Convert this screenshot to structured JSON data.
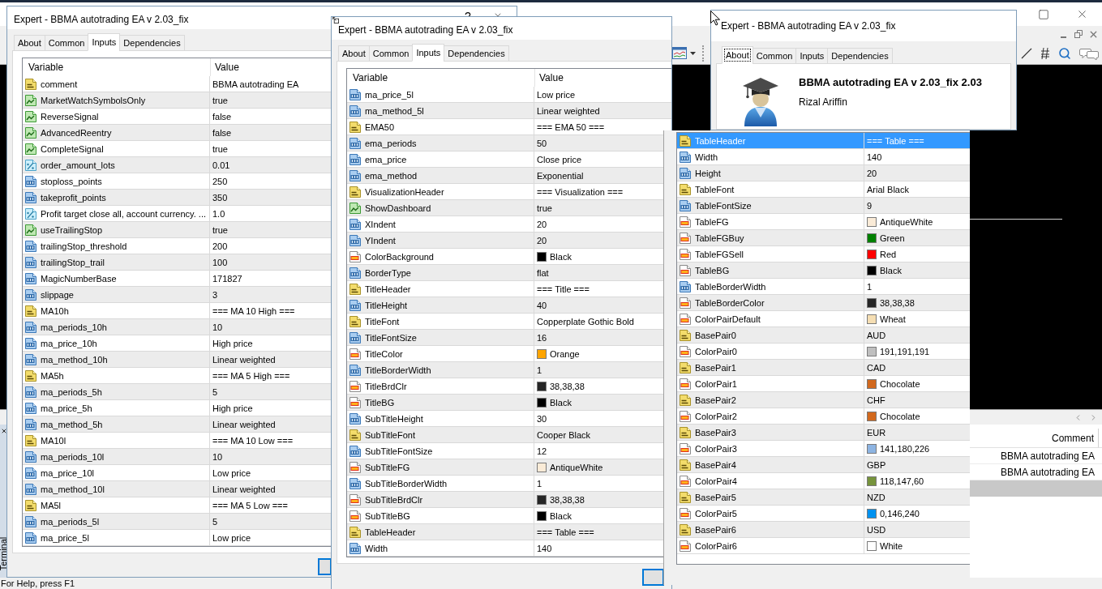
{
  "dialogs": [
    {
      "kind": "inputs",
      "title": "Expert - BBMA autotrading EA v 2.03_fix",
      "title_buttons": [
        {
          "kind": "help",
          "label": "?"
        },
        {
          "kind": "close"
        }
      ],
      "tabs": [
        {
          "label": "About",
          "selected": false
        },
        {
          "label": "Common",
          "selected": false
        },
        {
          "label": "Inputs",
          "selected": true
        },
        {
          "label": "Dependencies",
          "selected": false
        }
      ],
      "columns": [
        "Variable",
        "Value"
      ],
      "rows": [
        {
          "kind": "string",
          "variable": "comment",
          "value": "BBMA autotrading EA",
          "selected": false
        },
        {
          "kind": "bool",
          "variable": "MarketWatchSymbolsOnly",
          "value": "true",
          "selected": false
        },
        {
          "kind": "bool",
          "variable": "ReverseSignal",
          "value": "false",
          "selected": false
        },
        {
          "kind": "bool",
          "variable": "AdvancedReentry",
          "value": "false",
          "selected": false
        },
        {
          "kind": "bool",
          "variable": "CompleteSignal",
          "value": "true",
          "selected": false
        },
        {
          "kind": "double",
          "variable": "order_amount_lots",
          "value": "0.01",
          "selected": false
        },
        {
          "kind": "int",
          "variable": "stoploss_points",
          "value": "250",
          "selected": false
        },
        {
          "kind": "int",
          "variable": "takeprofit_points",
          "value": "350",
          "selected": false
        },
        {
          "kind": "double",
          "variable": "Profit target close all, account currency. ...",
          "value": "1.0",
          "selected": false
        },
        {
          "kind": "bool",
          "variable": "useTrailingStop",
          "value": "true",
          "selected": false
        },
        {
          "kind": "int",
          "variable": "trailingStop_threshold",
          "value": "200",
          "selected": false
        },
        {
          "kind": "int",
          "variable": "trailingStop_trail",
          "value": "100",
          "selected": false
        },
        {
          "kind": "int",
          "variable": "MagicNumberBase",
          "value": "171827",
          "selected": false
        },
        {
          "kind": "int",
          "variable": "slippage",
          "value": "3",
          "selected": false
        },
        {
          "kind": "string",
          "variable": "MA10h",
          "value": "=== MA 10 High ===",
          "selected": false
        },
        {
          "kind": "int",
          "variable": "ma_periods_10h",
          "value": "10",
          "selected": false
        },
        {
          "kind": "int",
          "variable": "ma_price_10h",
          "value": "High price",
          "selected": false
        },
        {
          "kind": "int",
          "variable": "ma_method_10h",
          "value": "Linear weighted",
          "selected": false
        },
        {
          "kind": "string",
          "variable": "MA5h",
          "value": "=== MA 5 High ===",
          "selected": false
        },
        {
          "kind": "int",
          "variable": "ma_periods_5h",
          "value": "5",
          "selected": false
        },
        {
          "kind": "int",
          "variable": "ma_price_5h",
          "value": "High price",
          "selected": false
        },
        {
          "kind": "int",
          "variable": "ma_method_5h",
          "value": "Linear weighted",
          "selected": false
        },
        {
          "kind": "string",
          "variable": "MA10l",
          "value": "=== MA 10 Low ===",
          "selected": false
        },
        {
          "kind": "int",
          "variable": "ma_periods_10l",
          "value": "10",
          "selected": false
        },
        {
          "kind": "int",
          "variable": "ma_price_10l",
          "value": "Low price",
          "selected": false
        },
        {
          "kind": "int",
          "variable": "ma_method_10l",
          "value": "Linear weighted",
          "selected": false
        },
        {
          "kind": "string",
          "variable": "MA5l",
          "value": "=== MA 5 Low ===",
          "selected": false
        },
        {
          "kind": "int",
          "variable": "ma_periods_5l",
          "value": "5",
          "selected": false
        },
        {
          "kind": "int",
          "variable": "ma_price_5l",
          "value": "Low price",
          "selected": false
        }
      ]
    },
    {
      "kind": "inputs",
      "title": "Expert - BBMA autotrading EA v 2.03_fix",
      "tabs": [
        {
          "label": "About",
          "selected": false
        },
        {
          "label": "Common",
          "selected": false
        },
        {
          "label": "Inputs",
          "selected": true
        },
        {
          "label": "Dependencies",
          "selected": false
        }
      ],
      "columns": [
        "Variable",
        "Value"
      ],
      "rows": [
        {
          "kind": "int",
          "variable": "ma_price_5l",
          "value": "Low price",
          "selected": false
        },
        {
          "kind": "int",
          "variable": "ma_method_5l",
          "value": "Linear weighted",
          "selected": false
        },
        {
          "kind": "string",
          "variable": "EMA50",
          "value": "=== EMA 50 ===",
          "selected": false
        },
        {
          "kind": "int",
          "variable": "ema_periods",
          "value": "50",
          "selected": false
        },
        {
          "kind": "int",
          "variable": "ema_price",
          "value": "Close price",
          "selected": false
        },
        {
          "kind": "int",
          "variable": "ema_method",
          "value": "Exponential",
          "selected": false
        },
        {
          "kind": "string",
          "variable": "VisualizationHeader",
          "value": "=== Visualization ===",
          "selected": false
        },
        {
          "kind": "bool",
          "variable": "ShowDashboard",
          "value": "true",
          "selected": false
        },
        {
          "kind": "int",
          "variable": "XIndent",
          "value": "20",
          "selected": false
        },
        {
          "kind": "int",
          "variable": "YIndent",
          "value": "20",
          "selected": false
        },
        {
          "kind": "color",
          "variable": "ColorBackground",
          "value": "Black",
          "color": "#000000",
          "selected": false
        },
        {
          "kind": "int",
          "variable": "BorderType",
          "value": "flat",
          "selected": false
        },
        {
          "kind": "string",
          "variable": "TitleHeader",
          "value": "=== Title ===",
          "selected": false
        },
        {
          "kind": "int",
          "variable": "TitleHeight",
          "value": "40",
          "selected": false
        },
        {
          "kind": "string",
          "variable": "TitleFont",
          "value": "Copperplate Gothic Bold",
          "selected": false
        },
        {
          "kind": "int",
          "variable": "TitleFontSize",
          "value": "16",
          "selected": false
        },
        {
          "kind": "color",
          "variable": "TitleColor",
          "value": "Orange",
          "color": "#ffa500",
          "selected": false
        },
        {
          "kind": "int",
          "variable": "TitleBorderWidth",
          "value": "1",
          "selected": false
        },
        {
          "kind": "color",
          "variable": "TitleBrdClr",
          "value": "38,38,38",
          "color": "#262626",
          "selected": false
        },
        {
          "kind": "color",
          "variable": "TitleBG",
          "value": "Black",
          "color": "#000000",
          "selected": false
        },
        {
          "kind": "int",
          "variable": "SubTitleHeight",
          "value": "30",
          "selected": false
        },
        {
          "kind": "string",
          "variable": "SubTitleFont",
          "value": "Cooper Black",
          "selected": false
        },
        {
          "kind": "int",
          "variable": "SubTitleFontSize",
          "value": "12",
          "selected": false
        },
        {
          "kind": "color",
          "variable": "SubTitleFG",
          "value": "AntiqueWhite",
          "color": "#faebd7",
          "selected": false
        },
        {
          "kind": "int",
          "variable": "SubTitleBorderWidth",
          "value": "1",
          "selected": false
        },
        {
          "kind": "color",
          "variable": "SubTitleBrdClr",
          "value": "38,38,38",
          "color": "#262626",
          "selected": false
        },
        {
          "kind": "color",
          "variable": "SubTitleBG",
          "value": "Black",
          "color": "#000000",
          "selected": false
        },
        {
          "kind": "string",
          "variable": "TableHeader",
          "value": "=== Table ===",
          "selected": false
        },
        {
          "kind": "int",
          "variable": "Width",
          "value": "140",
          "selected": false
        }
      ]
    },
    {
      "kind": "about",
      "title": "Expert - BBMA autotrading EA v 2.03_fix",
      "tabs": [
        {
          "label": "About",
          "selected": true,
          "focused": true
        },
        {
          "label": "Common",
          "selected": false,
          "focused": false
        },
        {
          "label": "Inputs",
          "selected": false,
          "focused": false
        },
        {
          "label": "Dependencies",
          "selected": false,
          "focused": false
        }
      ],
      "about": {
        "name": "BBMA autotrading EA v 2.03_fix 2.03",
        "author": "Rizal Ariffin"
      }
    }
  ],
  "inputs_panel": {
    "rows": [
      {
        "kind": "string",
        "variable": "TableHeader",
        "value": "=== Table ===",
        "selected": true
      },
      {
        "kind": "int",
        "variable": "Width",
        "value": "140",
        "selected": false
      },
      {
        "kind": "int",
        "variable": "Height",
        "value": "20",
        "selected": false
      },
      {
        "kind": "string",
        "variable": "TableFont",
        "value": "Arial Black",
        "selected": false
      },
      {
        "kind": "int",
        "variable": "TableFontSize",
        "value": "9",
        "selected": false
      },
      {
        "kind": "color",
        "variable": "TableFG",
        "value": "AntiqueWhite",
        "color": "#faebd7",
        "selected": false
      },
      {
        "kind": "color",
        "variable": "TableFGBuy",
        "value": "Green",
        "color": "#008000",
        "selected": false
      },
      {
        "kind": "color",
        "variable": "TableFGSell",
        "value": "Red",
        "color": "#ff0000",
        "selected": false
      },
      {
        "kind": "color",
        "variable": "TableBG",
        "value": "Black",
        "color": "#000000",
        "selected": false
      },
      {
        "kind": "int",
        "variable": "TableBorderWidth",
        "value": "1",
        "selected": false
      },
      {
        "kind": "color",
        "variable": "TableBorderColor",
        "value": "38,38,38",
        "color": "#262626",
        "selected": false
      },
      {
        "kind": "color",
        "variable": "ColorPairDefault",
        "value": "Wheat",
        "color": "#f5deb3",
        "selected": false
      },
      {
        "kind": "string",
        "variable": "BasePair0",
        "value": "AUD",
        "selected": false
      },
      {
        "kind": "color",
        "variable": "ColorPair0",
        "value": "191,191,191",
        "color": "#bfbfbf",
        "selected": false
      },
      {
        "kind": "string",
        "variable": "BasePair1",
        "value": "CAD",
        "selected": false
      },
      {
        "kind": "color",
        "variable": "ColorPair1",
        "value": "Chocolate",
        "color": "#d2691e",
        "selected": false
      },
      {
        "kind": "string",
        "variable": "BasePair2",
        "value": "CHF",
        "selected": false
      },
      {
        "kind": "color",
        "variable": "ColorPair2",
        "value": "Chocolate",
        "color": "#d2691e",
        "selected": false
      },
      {
        "kind": "string",
        "variable": "BasePair3",
        "value": "EUR",
        "selected": false
      },
      {
        "kind": "color",
        "variable": "ColorPair3",
        "value": "141,180,226",
        "color": "#8db4e2",
        "selected": false
      },
      {
        "kind": "string",
        "variable": "BasePair4",
        "value": "GBP",
        "selected": false
      },
      {
        "kind": "color",
        "variable": "ColorPair4",
        "value": "118,147,60",
        "color": "#76933c",
        "selected": false
      },
      {
        "kind": "string",
        "variable": "BasePair5",
        "value": "NZD",
        "selected": false
      },
      {
        "kind": "color",
        "variable": "ColorPair5",
        "value": "0,146,240",
        "color": "#0092f0",
        "selected": false
      },
      {
        "kind": "string",
        "variable": "BasePair6",
        "value": "USD",
        "selected": false
      },
      {
        "kind": "color",
        "variable": "ColorPair6",
        "value": "White",
        "color": "#ffffff",
        "selected": false
      }
    ]
  },
  "terminal": {
    "side_tab": "Terminal",
    "columns": [
      "Comment"
    ],
    "rows": [
      {
        "comment": "BBMA autotrading EA",
        "selected": false
      },
      {
        "comment": "BBMA autotrading EA",
        "selected": false
      },
      {
        "selected": true
      }
    ],
    "status_text": "For Help, press F1"
  }
}
